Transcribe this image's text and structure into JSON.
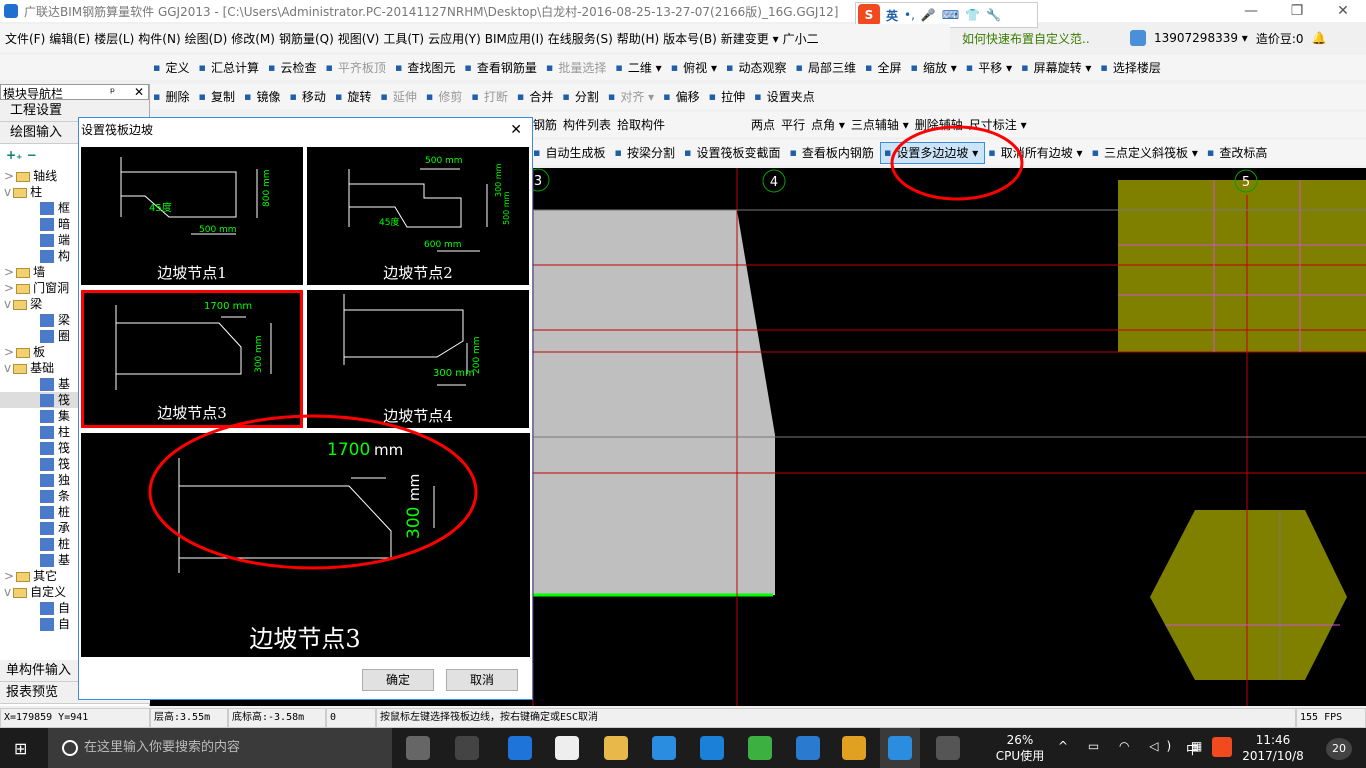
{
  "window": {
    "title": "广联达BIM钢筋算量软件 GGJ2013 - [C:\\Users\\Administrator.PC-20141127NRHM\\Desktop\\白龙村-2016-08-25-13-27-07(2166版)_16G.GGJ12]",
    "minimize": "—",
    "restore": "❐",
    "close": "✕"
  },
  "ime": {
    "logo": "S",
    "items": [
      "英",
      "•,",
      "🎤",
      "⌨",
      "👕",
      "🔧"
    ]
  },
  "menu": [
    "文件(F)",
    "编辑(E)",
    "楼层(L)",
    "构件(N)",
    "绘图(D)",
    "修改(M)",
    "钢筋量(Q)",
    "视图(V)",
    "工具(T)",
    "云应用(Y)",
    "BIM应用(I)",
    "在线服务(S)",
    "帮助(H)",
    "版本号(B)",
    "新建变更 ▾",
    "广小二"
  ],
  "menu_tip": "如何快速布置自定义范..",
  "account": {
    "phone": "13907298339 ▾",
    "beans": "造价豆:0"
  },
  "toolbar1": [
    "定义",
    "汇总计算",
    "云检查",
    "平齐板顶",
    "查找图元",
    "查看钢筋量",
    "批量选择",
    "二维 ▾",
    "俯视 ▾",
    "动态观察",
    "局部三维",
    "全屏",
    "缩放 ▾",
    "平移 ▾",
    "屏幕旋转 ▾",
    "选择楼层"
  ],
  "toolbar2": [
    "删除",
    "复制",
    "镜像",
    "移动",
    "旋转",
    "延伸",
    "修剪",
    "打断",
    "合并",
    "分割",
    "对齐 ▾",
    "偏移",
    "拉伸",
    "设置夹点"
  ],
  "toolbar3a": [
    "钢筋",
    "构件列表",
    "拾取构件"
  ],
  "toolbar3b": [
    "两点",
    "平行",
    "点角 ▾",
    "三点辅轴 ▾",
    "删除辅轴",
    "尺寸标注 ▾"
  ],
  "toolbar4": [
    "自动生成板",
    "按梁分割",
    "设置筏板变截面",
    "查看板内钢筋",
    "设置多边边坡 ▾",
    "取消所有边坡 ▾",
    "三点定义斜筏板 ▾",
    "查改标高"
  ],
  "nav": {
    "title": "模块导航栏",
    "pin": "ᵖ",
    "close": "✕",
    "top_buttons": [
      "工程设置",
      "绘图输入"
    ],
    "tree": [
      {
        "label": "轴线",
        "lvl": 0,
        "exp": ">"
      },
      {
        "label": "柱",
        "lvl": 0,
        "exp": "v"
      },
      {
        "label": "框",
        "lvl": 1
      },
      {
        "label": "暗",
        "lvl": 1
      },
      {
        "label": "端",
        "lvl": 1
      },
      {
        "label": "构",
        "lvl": 1
      },
      {
        "label": "墙",
        "lvl": 0,
        "exp": ">"
      },
      {
        "label": "门窗洞",
        "lvl": 0,
        "exp": ">"
      },
      {
        "label": "梁",
        "lvl": 0,
        "exp": "v"
      },
      {
        "label": "梁",
        "lvl": 1
      },
      {
        "label": "圈",
        "lvl": 1
      },
      {
        "label": "板",
        "lvl": 0,
        "exp": ">"
      },
      {
        "label": "基础",
        "lvl": 0,
        "exp": "v"
      },
      {
        "label": "基",
        "lvl": 1
      },
      {
        "label": "筏",
        "lvl": 1,
        "sel": true
      },
      {
        "label": "集",
        "lvl": 1
      },
      {
        "label": "柱",
        "lvl": 1
      },
      {
        "label": "筏",
        "lvl": 1
      },
      {
        "label": "筏",
        "lvl": 1
      },
      {
        "label": "独",
        "lvl": 1
      },
      {
        "label": "条",
        "lvl": 1
      },
      {
        "label": "桩",
        "lvl": 1
      },
      {
        "label": "承",
        "lvl": 1
      },
      {
        "label": "桩",
        "lvl": 1
      },
      {
        "label": "基",
        "lvl": 1
      },
      {
        "label": "其它",
        "lvl": 0,
        "exp": ">"
      },
      {
        "label": "自定义",
        "lvl": 0,
        "exp": "v"
      },
      {
        "label": "自",
        "lvl": 1
      },
      {
        "label": "自",
        "lvl": 1
      }
    ],
    "bottom_buttons": [
      "单构件输入",
      "报表预览"
    ]
  },
  "dialog": {
    "title": "设置筏板边坡",
    "close": "✕",
    "options": [
      {
        "caption": "边坡节点1",
        "dims": [
          "45度",
          "800 mm",
          "500 mm"
        ]
      },
      {
        "caption": "边坡节点2",
        "dims": [
          "500 mm",
          "300 mm",
          "500 mm",
          "45度",
          "600 mm"
        ]
      },
      {
        "caption": "边坡节点3",
        "dims": [
          "1700 mm",
          "300 mm"
        ],
        "selected": true
      },
      {
        "caption": "边坡节点4",
        "dims": [
          "200 mm",
          "300 mm"
        ]
      }
    ],
    "preview": {
      "caption": "边坡节点3",
      "dim1": "1700",
      "dim1_unit": "mm",
      "dim2": "300",
      "dim2_unit": "mm"
    },
    "ok": "确定",
    "cancel": "取消"
  },
  "axes": [
    "3",
    "4",
    "5"
  ],
  "status": {
    "coords": "X=179859 Y=941",
    "floor_height": "层高:3.55m",
    "bottom_elev": "底标高:-3.58m",
    "value": "0",
    "hint": "按鼠标左键选择筏板边线，按右键确定或ESC取消",
    "fps": "155 FPS"
  },
  "taskbar": {
    "search_placeholder": "在这里输入你要搜索的内容",
    "cpu": "26%",
    "cpu_label": "CPU使用",
    "lang": "中",
    "time": "11:46",
    "date": "2017/10/8",
    "notif": "20"
  },
  "colors": {
    "annotation": "#ff0000",
    "canvas": "#000000",
    "slab": "#bfbfbf",
    "olive": "#808000",
    "dim_text": "#00ff00",
    "grid_red": "#c00000"
  }
}
